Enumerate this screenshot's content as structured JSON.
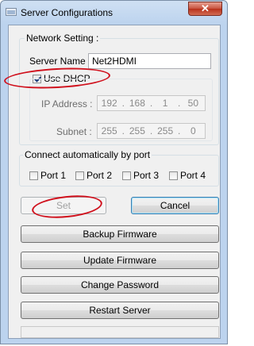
{
  "window": {
    "title": "Server Configurations"
  },
  "network": {
    "legend": "Network Setting :",
    "server_name_label": "Server Name :",
    "server_name_value": "Net2HDMI",
    "use_dhcp_label": "Use DHCP",
    "use_dhcp_checked": true,
    "ip_label": "IP Address :",
    "ip": [
      "192",
      "168",
      "1",
      "50"
    ],
    "subnet_label": "Subnet :",
    "subnet": [
      "255",
      "255",
      "255",
      "0"
    ]
  },
  "connect": {
    "legend": "Connect automatically by port",
    "ports": [
      "Port 1",
      "Port 2",
      "Port 3",
      "Port 4"
    ]
  },
  "buttons": {
    "set": "Set",
    "cancel": "Cancel",
    "backup": "Backup Firmware",
    "update": "Update Firmware",
    "change_password": "Change Password",
    "restart": "Restart Server"
  },
  "colors": {
    "annotation": "#d0101c",
    "title_gradient": "#bcd3ee"
  }
}
